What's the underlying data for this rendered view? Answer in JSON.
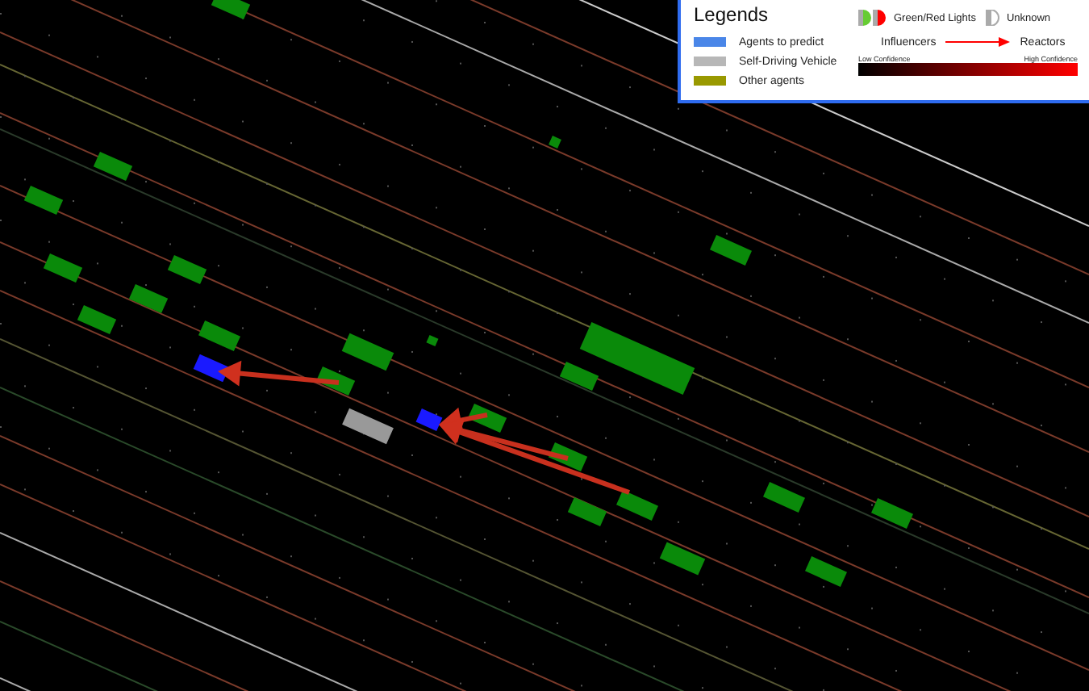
{
  "legend": {
    "title": "Legends",
    "agent_types": [
      {
        "label": "Agents to predict",
        "color": "#4a86e8"
      },
      {
        "label": "Self-Driving Vehicle",
        "color": "#b7b7b7"
      },
      {
        "label": "Other agents",
        "color": "#999900"
      }
    ],
    "lights": [
      {
        "kind": "green_red",
        "label": "Green/Red Lights"
      },
      {
        "kind": "unknown",
        "label": "Unknown"
      }
    ],
    "relation": {
      "from": "Influencers",
      "to": "Reactors"
    },
    "confidence": {
      "low": "Low Confidence",
      "high": "High Confidence"
    }
  }
}
